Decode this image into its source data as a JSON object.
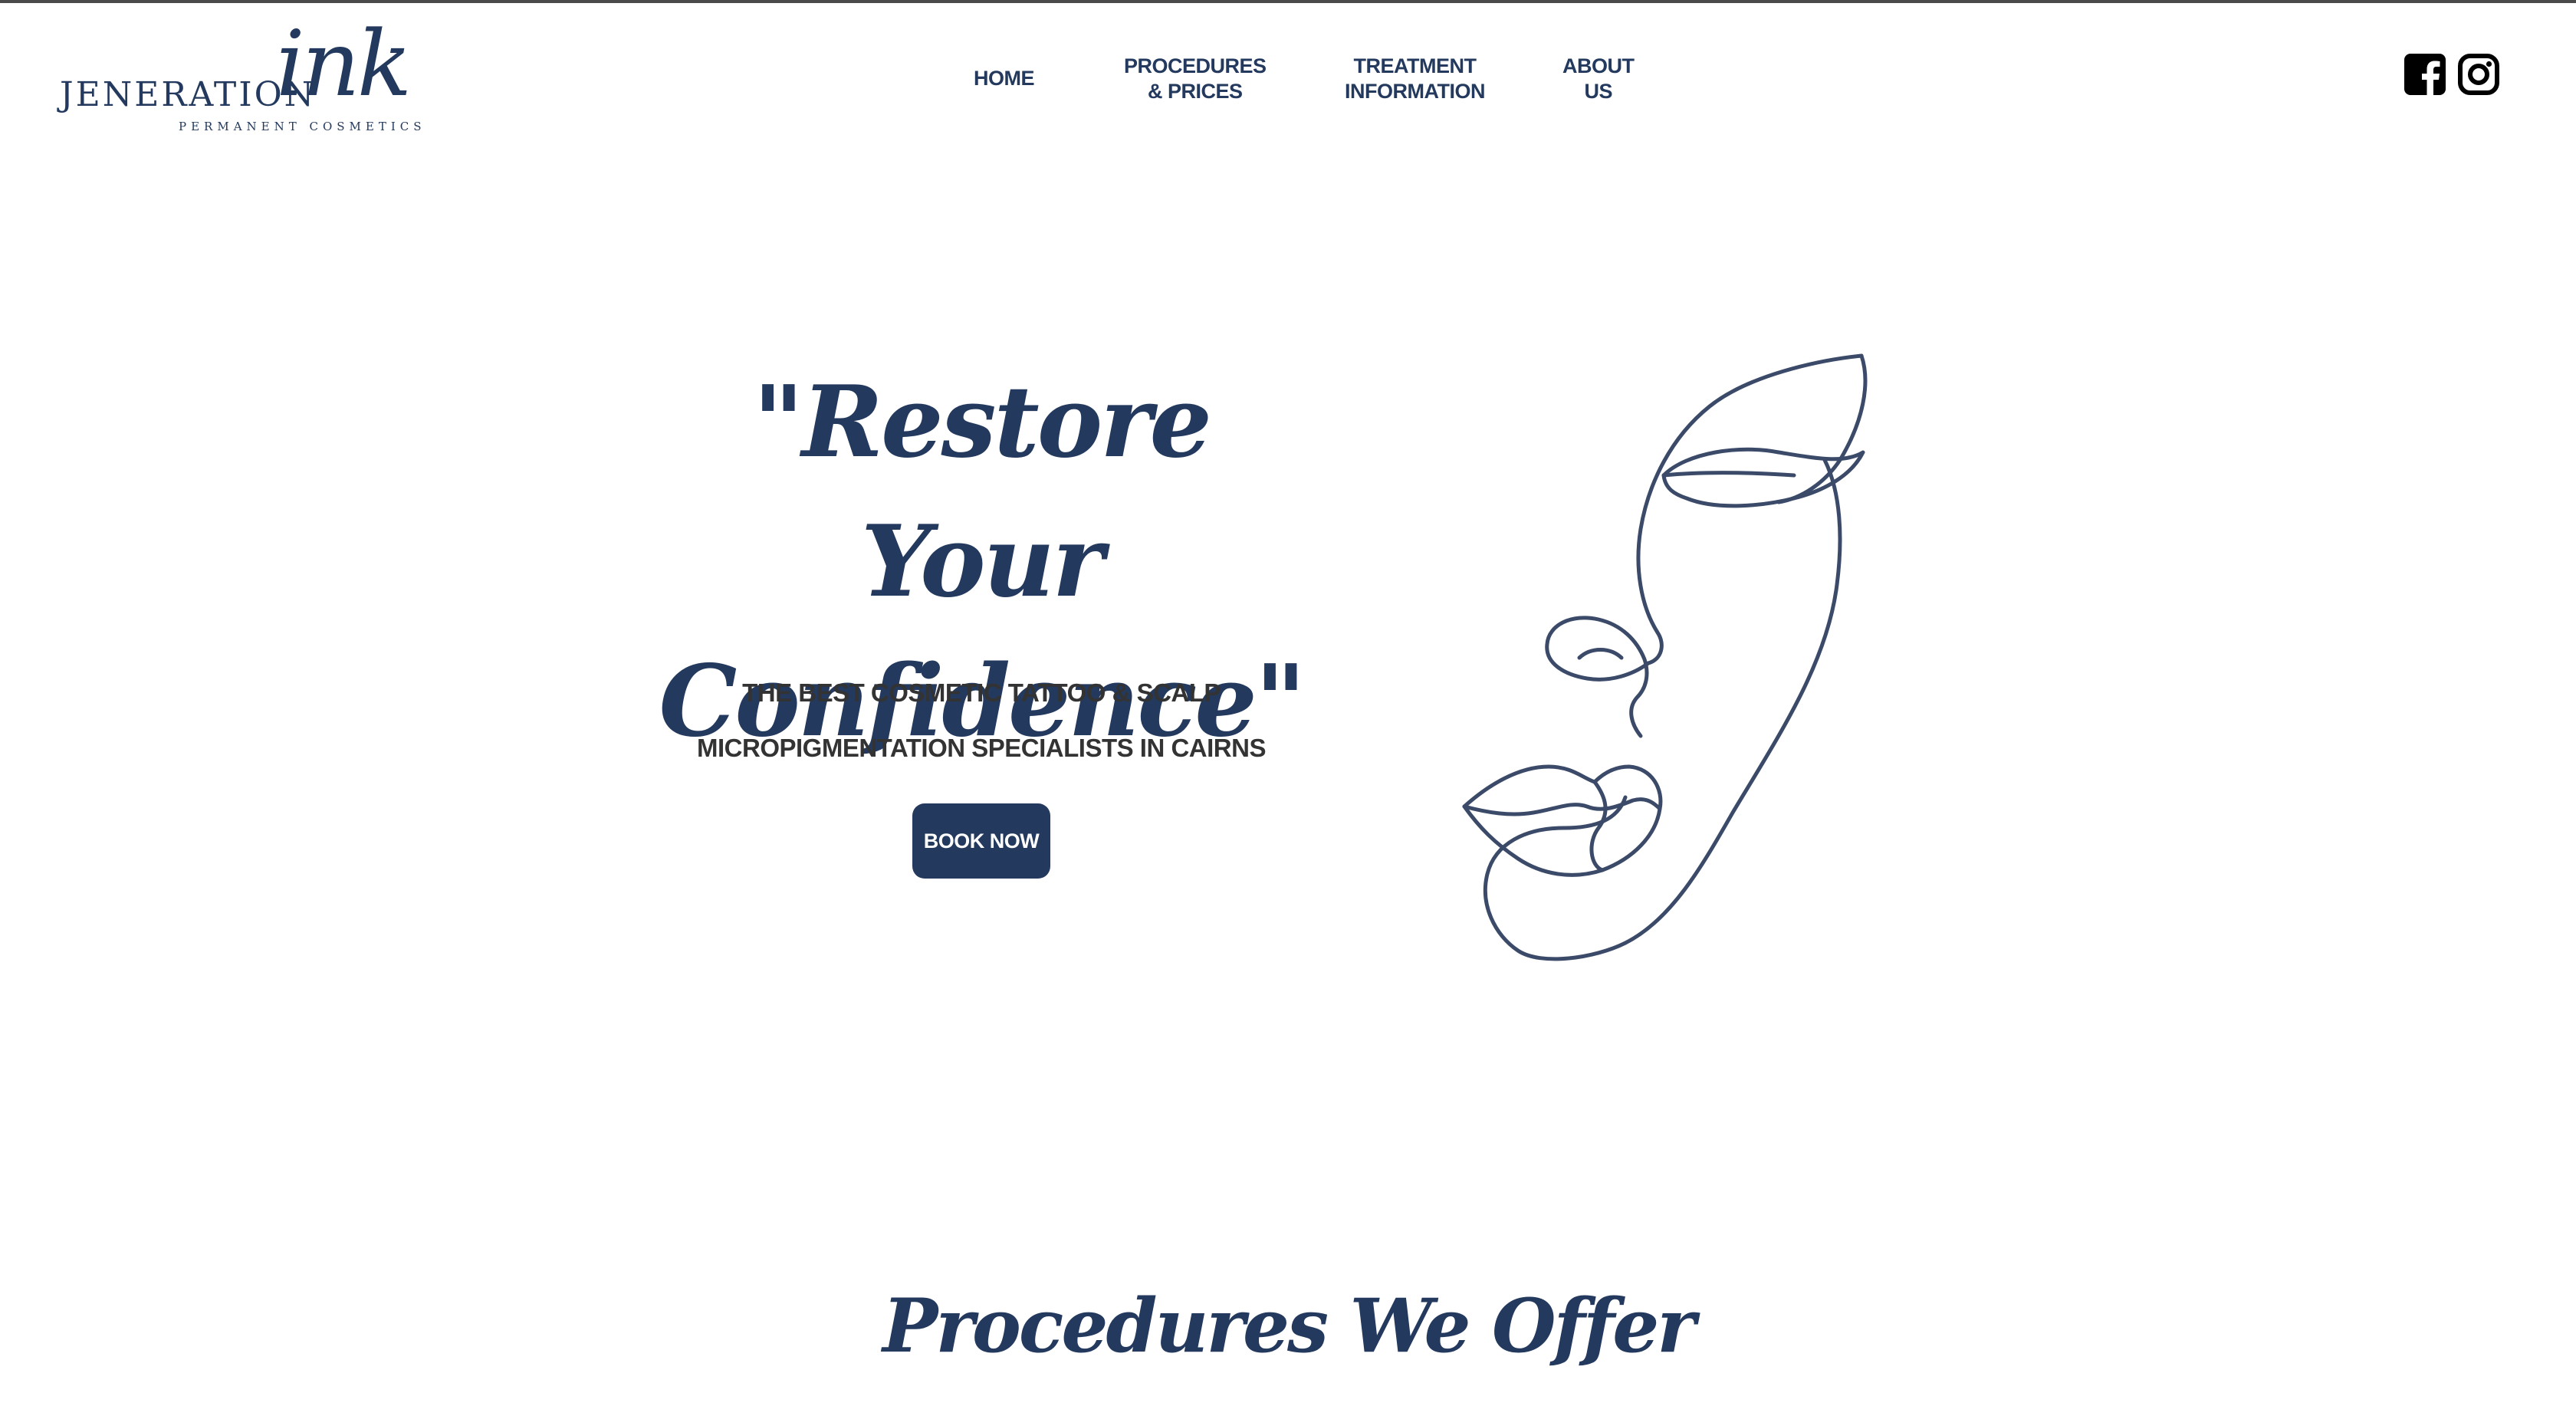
{
  "brand": {
    "logo_word": "JENERATION",
    "logo_script": "ink",
    "logo_tagline": "PERMANENT COSMETICS",
    "primary_color": "#23395d"
  },
  "nav": {
    "items": [
      {
        "line1": "HOME",
        "line2": ""
      },
      {
        "line1": "PROCEDURES",
        "line2": "& PRICES"
      },
      {
        "line1": "TREATMENT",
        "line2": "INFORMATION"
      },
      {
        "line1": "ABOUT",
        "line2": "US"
      }
    ]
  },
  "social": {
    "icons": [
      "facebook-icon",
      "instagram-icon"
    ]
  },
  "hero": {
    "title_line1": "\"Restore Your",
    "title_line2": "Confidence\"",
    "subtitle_line1": "THE BEST COSMETIC TATTOO & SCALP",
    "subtitle_line2": "MICROPIGMENTATION SPECIALISTS IN CAIRNS",
    "cta_label": "BOOK NOW",
    "illustration": "face-line-art"
  },
  "sections": {
    "procedures_title": "Procedures We Offer"
  }
}
